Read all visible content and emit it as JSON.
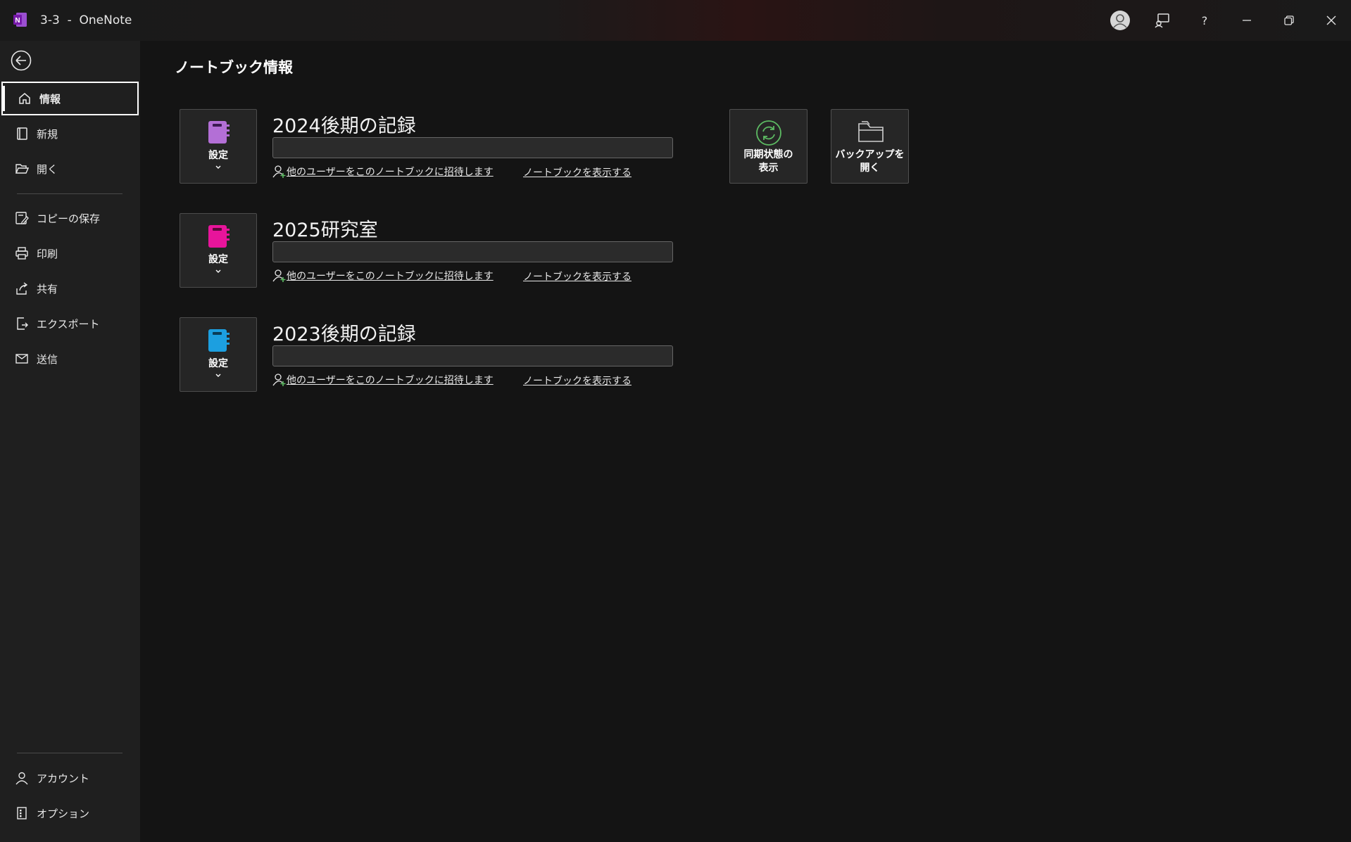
{
  "window": {
    "title": "3-3  -  OneNote",
    "app_color": "#7719AA"
  },
  "sidebar": {
    "items": [
      {
        "label": "情報",
        "icon": "home-icon",
        "active": true
      },
      {
        "label": "新規",
        "icon": "new-notebook-icon"
      },
      {
        "label": "開く",
        "icon": "folder-open-icon"
      },
      {
        "label": "コピーの保存",
        "icon": "save-copy-icon"
      },
      {
        "label": "印刷",
        "icon": "printer-icon"
      },
      {
        "label": "共有",
        "icon": "share-icon"
      },
      {
        "label": "エクスポート",
        "icon": "export-icon"
      },
      {
        "label": "送信",
        "icon": "send-icon"
      }
    ],
    "bottom_items": [
      {
        "label": "アカウント",
        "icon": "person-icon"
      },
      {
        "label": "オプション",
        "icon": "options-icon"
      }
    ]
  },
  "main": {
    "title": "ノートブック情報",
    "notebooks": [
      {
        "name": "2024後期の記録",
        "color": "#B36FD6",
        "settings_label": "設定",
        "path": "",
        "invite_label": "他のユーザーをこのノートブックに招待します",
        "view_label": "ノートブックを表示する"
      },
      {
        "name": "2025研究室",
        "color": "#E8149B",
        "settings_label": "設定",
        "path": "",
        "invite_label": "他のユーザーをこのノートブックに招待します",
        "view_label": "ノートブックを表示する"
      },
      {
        "name": "2023後期の記録",
        "color": "#1C9FE0",
        "settings_label": "設定",
        "path": "",
        "invite_label": "他のユーザーをこのノートブックに招待します",
        "view_label": "ノートブックを表示する"
      }
    ],
    "actions": {
      "sync_label_1": "同期状態の",
      "sync_label_2": "表示",
      "backup_label_1": "バックアップを",
      "backup_label_2": "開く"
    }
  },
  "colors": {
    "sync_green": "#5DBB63",
    "invite_plus_green": "#5DBB63"
  }
}
